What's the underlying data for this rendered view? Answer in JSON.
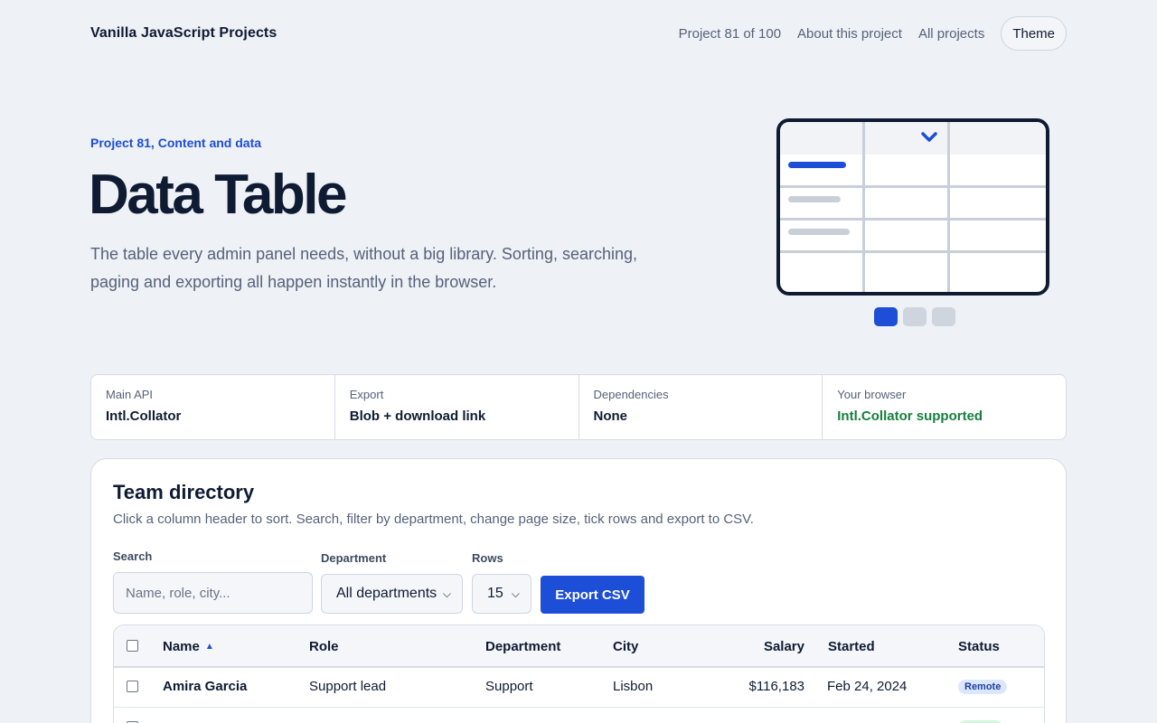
{
  "header": {
    "brand": "Vanilla JavaScript Projects",
    "nav": {
      "project_count": "Project 81 of 100",
      "about": "About this project",
      "all_projects": "All projects",
      "theme": "Theme"
    }
  },
  "hero": {
    "eyebrow": "Project 81, Content and data",
    "title": "Data Table",
    "description": "The table every admin panel needs, without a big library. Sorting, searching, paging and exporting all happen instantly in the browser.",
    "illustration": {
      "accent_color": "#1d4ed8",
      "active_dot": 1,
      "dot_count": 3
    }
  },
  "info": [
    {
      "label": "Main API",
      "value": "Intl.Collator"
    },
    {
      "label": "Export",
      "value": "Blob + download link"
    },
    {
      "label": "Dependencies",
      "value": "None"
    },
    {
      "label": "Your browser",
      "value": "Intl.Collator supported",
      "status_color": "#15803d"
    }
  ],
  "directory": {
    "title": "Team directory",
    "subtitle": "Click a column header to sort. Search, filter by department, change page size, tick rows and export to CSV.",
    "search": {
      "label": "Search",
      "placeholder": "Name, role, city..."
    },
    "department": {
      "label": "Department",
      "selected": "All departments"
    },
    "rows": {
      "label": "Rows",
      "selected": "15"
    },
    "export_label": "Export CSV",
    "columns": {
      "name": "Name",
      "role": "Role",
      "department": "Department",
      "city": "City",
      "salary": "Salary",
      "started": "Started",
      "status": "Status"
    },
    "sort": {
      "column": "Name",
      "direction": "ascending"
    },
    "table_rows": [
      {
        "name": "Amira Garcia",
        "role": "Support lead",
        "department": "Support",
        "city": "Lisbon",
        "salary": "$116,183",
        "started": "Feb 24, 2024",
        "status": "Remote"
      }
    ]
  },
  "colors": {
    "accent": "#1d4ed8",
    "success": "#15803d",
    "background": "#eef1f5",
    "text": "#0f1b33",
    "muted": "#56627a"
  }
}
